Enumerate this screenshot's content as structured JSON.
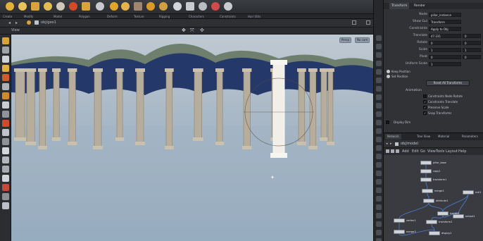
{
  "shelf": {
    "icons": [
      {
        "name": "sphere-tool-icon",
        "color": "#e2b13c"
      },
      {
        "name": "torus-tool-icon",
        "color": "#e9c45a"
      },
      {
        "name": "grid-tool-icon",
        "color": "#d9a33a"
      },
      {
        "name": "tube-tool-icon",
        "color": "#e3bd54"
      },
      {
        "name": "circle-tool-icon",
        "color": "#cfc7b9"
      },
      {
        "name": "ball-tool-icon",
        "color": "#d24a2a"
      },
      {
        "name": "box-tool-icon",
        "color": "#d9a33a"
      },
      {
        "name": "star-tool-icon",
        "color": "#c8c9cc"
      },
      {
        "name": "diamond-tool-icon",
        "color": "#e1a52a"
      },
      {
        "name": "shell-tool-icon",
        "color": "#e3b24b"
      },
      {
        "name": "texture-tool-icon",
        "color": "#a08670"
      },
      {
        "name": "cube-tool-icon",
        "color": "#d99a2a"
      },
      {
        "name": "leaf-tool-icon",
        "color": "#cfa043"
      },
      {
        "name": "cone-tool-icon",
        "color": "#d2d5da"
      },
      {
        "name": "donut-tool-icon",
        "color": "#c8cbd0"
      },
      {
        "name": "lens-tool-icon",
        "color": "#b9bdc2"
      },
      {
        "name": "tag-tool-icon",
        "color": "#d24a4a"
      },
      {
        "name": "pencil-tool-icon",
        "color": "#c9ccd1"
      }
    ],
    "tabs": [
      "Create",
      "Modify",
      "Model",
      "Polygon",
      "Deform",
      "Texture",
      "Rigging",
      "Characters",
      "Constraints",
      "Hair Utils"
    ]
  },
  "path": {
    "text": "obj/geo1"
  },
  "viewport": {
    "label": "View",
    "camera_button": "Persp",
    "cam_button": "No cam"
  },
  "params": {
    "tabs": [
      "Transform",
      "Render"
    ],
    "rows": [
      {
        "label": "Node",
        "value": "pillar_instance",
        "value2": ""
      },
      {
        "label": "Show Gui",
        "value": "Transform",
        "value2": ""
      },
      {
        "label": "Constraints",
        "value": "Apply to Obj",
        "value2": ""
      },
      {
        "label": "Translate",
        "value": "47.231",
        "value2": "0"
      },
      {
        "label": "Rotate",
        "value": "0",
        "value2": "0"
      },
      {
        "label": "Scale",
        "value": "1",
        "value2": "1"
      },
      {
        "label": "Pivot",
        "value": "0",
        "value2": "0"
      },
      {
        "label": "Uniform Scale",
        "value": "1",
        "value2": ""
      }
    ],
    "radios": [
      "Keep Position",
      "Set Position"
    ],
    "button": "Reset All Transforms",
    "section": "Animation",
    "checks": [
      {
        "label": "Constraints Node Rotate",
        "checked": false
      },
      {
        "label": "Constraints Translate",
        "checked": true
      },
      {
        "label": "Preserve Scale",
        "checked": true
      },
      {
        "label": "Snap Transforms",
        "checked": true
      }
    ],
    "footer": "Display Dim"
  },
  "network": {
    "tabs": [
      "Network",
      "Tree View",
      "Material",
      "Parameters"
    ],
    "path": "obj/model",
    "menu": [
      "Add",
      "Edit",
      "Go",
      "View",
      "Tools",
      "Layout",
      "Help"
    ],
    "nodes": [
      {
        "label": "pillar_base"
      },
      {
        "label": "copy1"
      },
      {
        "label": "transform1"
      },
      {
        "label": "merge1"
      },
      {
        "label": "attribute1"
      },
      {
        "label": "null1"
      },
      {
        "label": "merge2"
      },
      {
        "label": "output1"
      },
      {
        "label": "vertex1"
      },
      {
        "label": "transform2"
      },
      {
        "label": "merge3"
      },
      {
        "label": "display1"
      }
    ]
  }
}
